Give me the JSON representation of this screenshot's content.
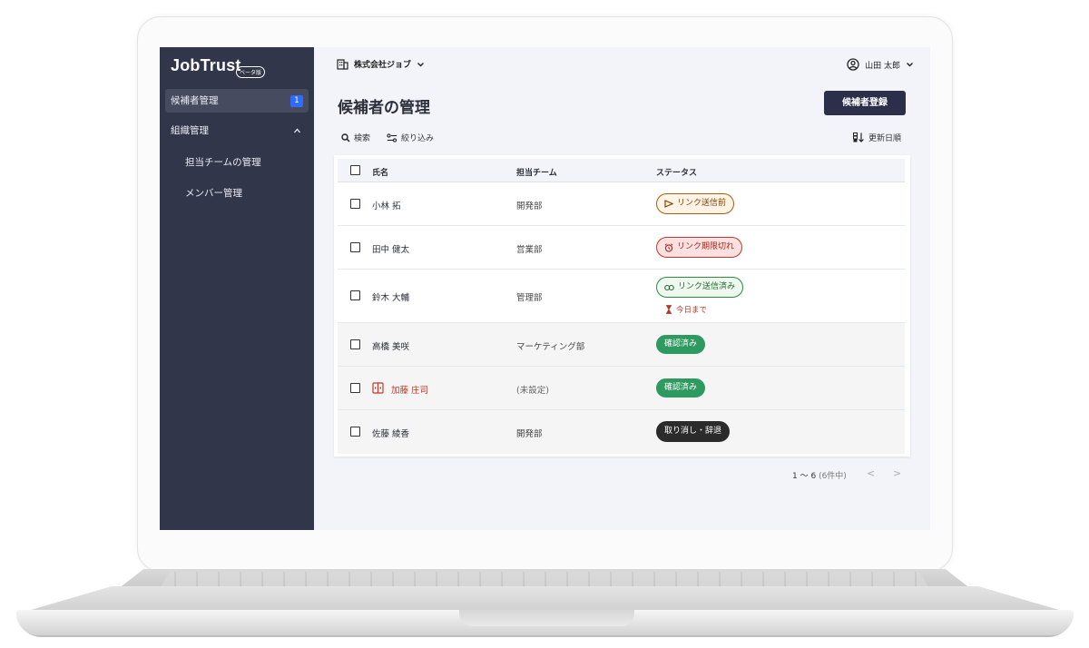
{
  "app": {
    "logo": "JobTrust",
    "beta_badge": "ベータ版"
  },
  "sidebar": {
    "items": [
      {
        "label": "候補者管理",
        "badge": "1"
      },
      {
        "label": "組織管理",
        "chevron": "^"
      }
    ],
    "subitems": [
      {
        "label": "担当チームの管理"
      },
      {
        "label": "メンバー管理"
      }
    ]
  },
  "topbar": {
    "company": "株式会社ジョブ",
    "user": "山田 太郎"
  },
  "page": {
    "title": "候補者の管理",
    "register_button": "候補者登録",
    "search": "検索",
    "filter": "絞り込み",
    "sort": "更新日順"
  },
  "table": {
    "headers": {
      "name": "氏名",
      "team": "担当チーム",
      "status": "ステータス"
    },
    "rows": [
      {
        "name": "小林 拓",
        "team": "開発部",
        "status": "リンク送信前"
      },
      {
        "name": "田中 健太",
        "team": "営業部",
        "status": "リンク期限切れ"
      },
      {
        "name": "鈴木 大輔",
        "team": "管理部",
        "status": "リンク送信済み",
        "deadline": "今日まで"
      },
      {
        "name": "高橋 美咲",
        "team": "マーケティング部",
        "status": "確認済み"
      },
      {
        "name": "加藤 庄司",
        "team": "(未設定)",
        "status": "確認済み"
      },
      {
        "name": "佐藤 綾香",
        "team": "開発部",
        "status": "取り消し・辞退"
      }
    ]
  },
  "pagination": {
    "range": "1 〜 6",
    "total": "(6件中)",
    "prev": "<",
    "next": ">"
  },
  "colors": {
    "sidebar_bg": "#32364a",
    "primary_button": "#2b2f4a",
    "badge_blue": "#2f6bff",
    "status_confirmed": "#2e9a5f",
    "status_expired": "#c0392b",
    "status_sent": "#2c8c3d",
    "status_before": "#b15a15"
  },
  "icons": [
    "building-icon",
    "chevron-down-icon",
    "user-circle-icon",
    "search-icon",
    "filter-icon",
    "sort-icon",
    "send-icon",
    "alarm-clock-icon",
    "link-icon",
    "hourglass-icon",
    "alert-door-icon",
    "chevron-left-icon",
    "chevron-right-icon"
  ]
}
